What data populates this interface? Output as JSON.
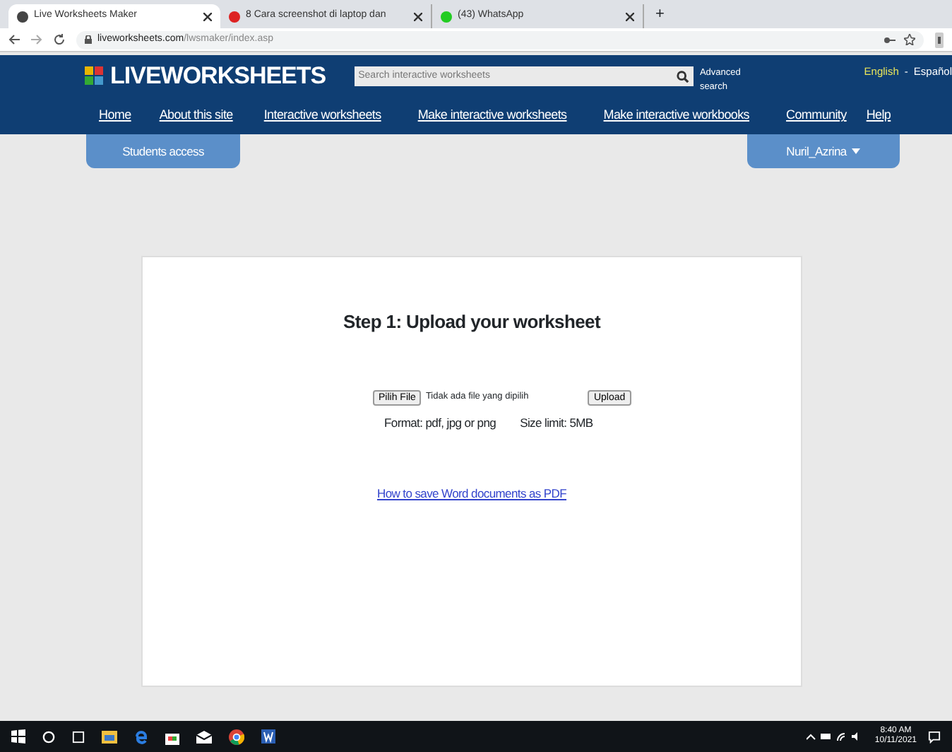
{
  "browser": {
    "tabs": [
      {
        "title": "Live Worksheets Maker",
        "selected": true
      },
      {
        "title": "8 Cara screenshot di laptop dan",
        "selected": false
      },
      {
        "title": "(43) WhatsApp",
        "selected": false
      }
    ],
    "new_tab": "+",
    "url_host": "liveworksheets.com",
    "url_path": "/lwsmaker/index.asp"
  },
  "site": {
    "logo": "LIVEWORKSHEETS",
    "search_placeholder": "Search interactive worksheets",
    "advanced_search": "Advanced search",
    "languages": [
      {
        "label": "English",
        "selected": true
      },
      {
        "label": "Español",
        "selected": false
      }
    ],
    "language_separator": "-",
    "nav": [
      "Home",
      "About this site",
      "Interactive worksheets",
      "Make interactive worksheets",
      "Make interactive workbooks",
      "Community",
      "Help"
    ],
    "students_access": "Students access",
    "user": "Nuril_Azrina"
  },
  "upload": {
    "title": "Step 1: Upload your worksheet",
    "file_button": "Pilih File",
    "file_status": "Tidak ada file yang dipilih",
    "upload_button": "Upload",
    "format": "Format: pdf, jpg or png",
    "size_limit": "Size limit: 5MB",
    "link": "How to save Word documents as PDF"
  },
  "taskbar": {
    "time": "8:40 AM",
    "date": "10/11/2021"
  }
}
